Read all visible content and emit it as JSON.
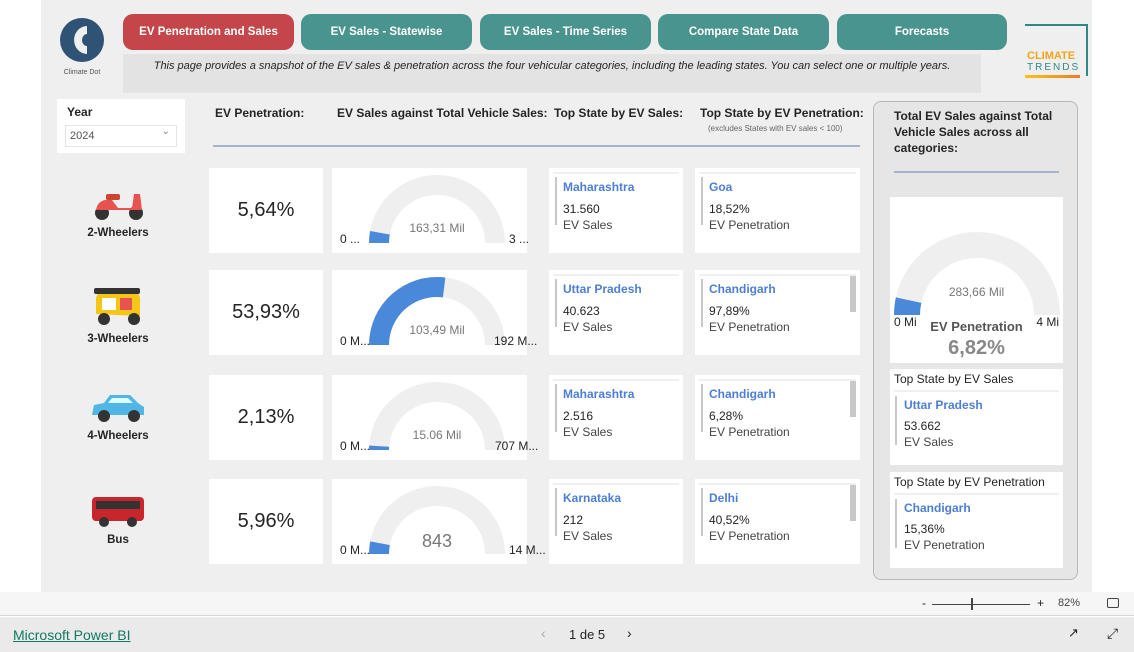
{
  "nav": {
    "tabs": [
      {
        "label": "EV Penetration and Sales",
        "active": true
      },
      {
        "label": "EV Sales - Statewise"
      },
      {
        "label": "EV Sales - Time Series"
      },
      {
        "label": "Compare State Data"
      },
      {
        "label": "Forecasts"
      }
    ]
  },
  "logo_left": "Climate Dot",
  "logo_right": [
    "CLIMATE",
    "TRENDS"
  ],
  "description": "This page provides a snapshot of the EV sales & penetration across the four vehicular categories, including the leading states. You can select one or multiple years.",
  "year_filter": {
    "label": "Year",
    "value": "2024"
  },
  "headers": {
    "penetration": "EV Penetration:",
    "gauge": "EV Sales against Total Vehicle Sales:",
    "top_sales": "Top State by EV Sales:",
    "top_pen": "Top State by EV Penetration:",
    "top_pen_note": "(excludes States with EV sales < 100)"
  },
  "colors": {
    "accent": "#4a88d9",
    "nav": "#4a9490",
    "nav_active": "#c4464a"
  },
  "rows": [
    {
      "vehicle": "2-Wheelers",
      "icon": "scooter-icon",
      "penetration": "5,64%",
      "gauge": {
        "value_label": "163,31 Mil",
        "min": "0 ...",
        "max": "3 ...",
        "fill": 0.0564
      },
      "top_sales": {
        "state": "Maharashtra",
        "value": "31.560",
        "label": "EV Sales"
      },
      "top_pen": {
        "state": "Goa",
        "value": "18,52%",
        "label": "EV Penetration"
      }
    },
    {
      "vehicle": "3-Wheelers",
      "icon": "auto-rickshaw-icon",
      "penetration": "53,93%",
      "gauge": {
        "value_label": "103,49 Mil",
        "min": "0 M...",
        "max": "192 M...",
        "fill": 0.5393
      },
      "top_sales": {
        "state": "Uttar Pradesh",
        "value": "40.623",
        "label": "EV Sales"
      },
      "top_pen": {
        "state": "Chandigarh",
        "value": "97,89%",
        "label": "EV Penetration"
      }
    },
    {
      "vehicle": "4-Wheelers",
      "icon": "car-icon",
      "penetration": "2,13%",
      "gauge": {
        "value_label": "15.06 Mil",
        "min": "0 M...",
        "max": "707 M...",
        "fill": 0.0213
      },
      "top_sales": {
        "state": "Maharashtra",
        "value": "2.516",
        "label": "EV Sales"
      },
      "top_pen": {
        "state": "Chandigarh",
        "value": "6,28%",
        "label": "EV Penetration"
      }
    },
    {
      "vehicle": "Bus",
      "icon": "bus-icon",
      "penetration": "5,96%",
      "gauge": {
        "value_label": "843",
        "min": "0 M...",
        "max": "14 M...",
        "fill": 0.0596
      },
      "top_sales": {
        "state": "Karnataka",
        "value": "212",
        "label": "EV Sales"
      },
      "top_pen": {
        "state": "Delhi",
        "value": "40,52%",
        "label": "EV Penetration"
      }
    }
  ],
  "total": {
    "title": "Total EV Sales against Total Vehicle Sales across all categories:",
    "gauge": {
      "value_label": "283,66 Mil",
      "min": "0 Mi",
      "max": "4 Mi",
      "fill": 0.0682
    },
    "pen_label": "EV Penetration",
    "pen_value": "6,82%",
    "top_sales": {
      "title": "Top State by EV Sales",
      "state": "Uttar Pradesh",
      "value": "53.662",
      "label": "EV Sales"
    },
    "top_pen": {
      "title": "Top State by EV Penetration",
      "state": "Chandigarh",
      "value": "15,36%",
      "label": "EV Penetration"
    }
  },
  "zoom": {
    "minus": "-",
    "plus": "+",
    "value": "82%",
    "level": 0.4
  },
  "footer": {
    "brand": "Microsoft Power BI",
    "page": "1 de 5"
  }
}
